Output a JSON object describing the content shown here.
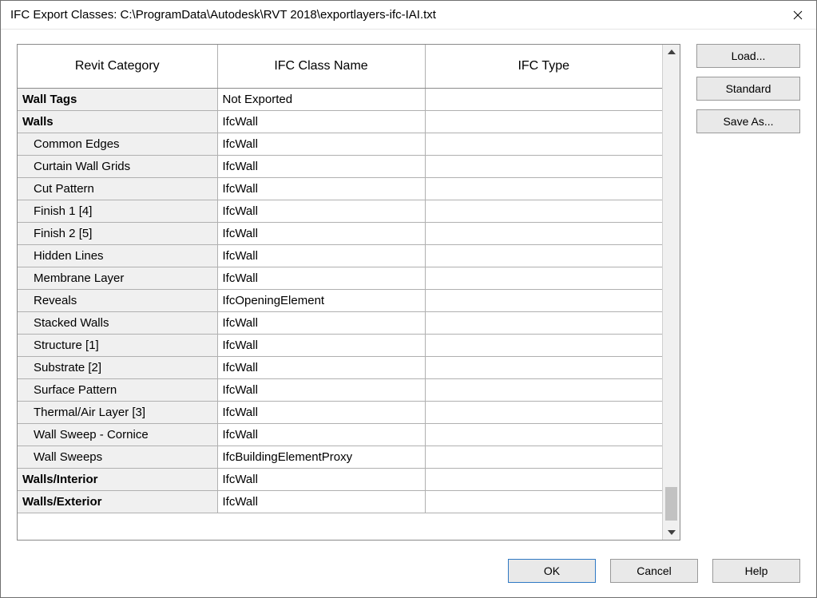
{
  "window_title": "IFC Export Classes: C:\\ProgramData\\Autodesk\\RVT 2018\\exportlayers-ifc-IAI.txt",
  "columns": {
    "category": "Revit Category",
    "class": "IFC Class Name",
    "type": "IFC Type"
  },
  "rows": [
    {
      "category": "Wall Tags",
      "class": "Not Exported",
      "type": "",
      "bold": true,
      "sub": false
    },
    {
      "category": "Walls",
      "class": "IfcWall",
      "type": "",
      "bold": true,
      "sub": false
    },
    {
      "category": "Common Edges",
      "class": "IfcWall",
      "type": "",
      "bold": false,
      "sub": true
    },
    {
      "category": "Curtain Wall Grids",
      "class": "IfcWall",
      "type": "",
      "bold": false,
      "sub": true
    },
    {
      "category": "Cut Pattern",
      "class": "IfcWall",
      "type": "",
      "bold": false,
      "sub": true
    },
    {
      "category": "Finish 1 [4]",
      "class": "IfcWall",
      "type": "",
      "bold": false,
      "sub": true
    },
    {
      "category": "Finish 2 [5]",
      "class": "IfcWall",
      "type": "",
      "bold": false,
      "sub": true
    },
    {
      "category": "Hidden Lines",
      "class": "IfcWall",
      "type": "",
      "bold": false,
      "sub": true
    },
    {
      "category": "Membrane Layer",
      "class": "IfcWall",
      "type": "",
      "bold": false,
      "sub": true
    },
    {
      "category": "Reveals",
      "class": "IfcOpeningElement",
      "type": "",
      "bold": false,
      "sub": true
    },
    {
      "category": "Stacked Walls",
      "class": "IfcWall",
      "type": "",
      "bold": false,
      "sub": true
    },
    {
      "category": "Structure [1]",
      "class": "IfcWall",
      "type": "",
      "bold": false,
      "sub": true
    },
    {
      "category": "Substrate [2]",
      "class": "IfcWall",
      "type": "",
      "bold": false,
      "sub": true
    },
    {
      "category": "Surface Pattern",
      "class": "IfcWall",
      "type": "",
      "bold": false,
      "sub": true
    },
    {
      "category": "Thermal/Air Layer [3]",
      "class": "IfcWall",
      "type": "",
      "bold": false,
      "sub": true
    },
    {
      "category": "Wall Sweep - Cornice",
      "class": "IfcWall",
      "type": "",
      "bold": false,
      "sub": true
    },
    {
      "category": "Wall Sweeps",
      "class": "IfcBuildingElementProxy",
      "type": "",
      "bold": false,
      "sub": true
    },
    {
      "category": "Walls/Interior",
      "class": "IfcWall",
      "type": "",
      "bold": true,
      "sub": false
    },
    {
      "category": "Walls/Exterior",
      "class": "IfcWall",
      "type": "",
      "bold": true,
      "sub": false
    }
  ],
  "side": {
    "load": "Load...",
    "standard": "Standard",
    "save_as": "Save As..."
  },
  "footer": {
    "ok": "OK",
    "cancel": "Cancel",
    "help": "Help"
  }
}
